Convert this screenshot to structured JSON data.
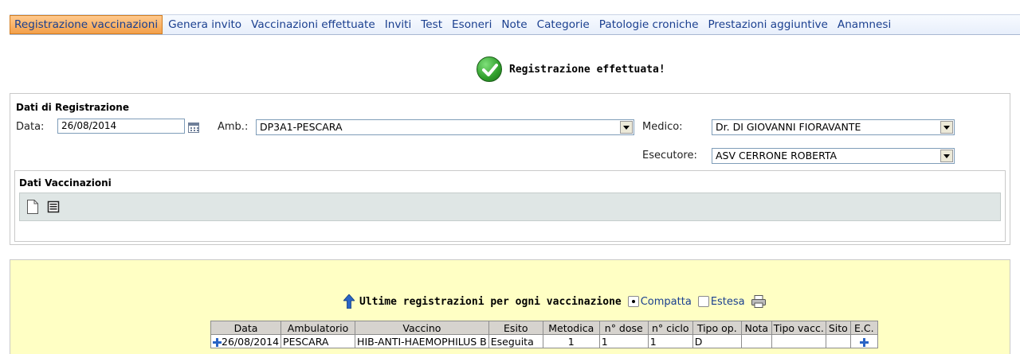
{
  "tabs": [
    {
      "label": "Registrazione vaccinazioni",
      "active": true
    },
    {
      "label": "Genera invito",
      "active": false
    },
    {
      "label": "Vaccinazioni effettuate",
      "active": false
    },
    {
      "label": "Inviti",
      "active": false
    },
    {
      "label": "Test",
      "active": false
    },
    {
      "label": "Esoneri",
      "active": false
    },
    {
      "label": "Note",
      "active": false
    },
    {
      "label": "Categorie",
      "active": false
    },
    {
      "label": "Patologie croniche",
      "active": false
    },
    {
      "label": "Prestazioni aggiuntive",
      "active": false
    },
    {
      "label": "Anamnesi",
      "active": false
    }
  ],
  "message": {
    "text": "Registrazione effettuata!",
    "icon": "check-circle-icon"
  },
  "registration": {
    "title": "Dati di Registrazione",
    "data_label": "Data:",
    "data_value": "26/08/2014",
    "amb_label": "Amb.:",
    "amb_value": "DP3A1-PESCARA",
    "medico_label": "Medico:",
    "medico_value": "Dr. DI GIOVANNI FIORAVANTE",
    "esecutore_label": "Esecutore:",
    "esecutore_value": "ASV CERRONE ROBERTA"
  },
  "vaccinations": {
    "title": "Dati Vaccinazioni",
    "buttons": [
      {
        "icon": "new-document-icon"
      },
      {
        "icon": "list-icon"
      }
    ]
  },
  "latest": {
    "title": "Ultime registrazioni per ogni vaccinazione",
    "options": [
      {
        "label": "Compatta",
        "selected": true
      },
      {
        "label": "Estesa",
        "selected": false
      }
    ],
    "columns": [
      "Data",
      "Ambulatorio",
      "Vaccino",
      "Esito",
      "Metodica",
      "n° dose",
      "n° ciclo",
      "Tipo op.",
      "Nota",
      "Tipo vacc.",
      "Sito",
      "E.C."
    ],
    "rows": [
      [
        "26/08/2014",
        "PESCARA",
        "HIB-ANTI-HAEMOPHILUS B",
        "Eseguita",
        "1",
        "1",
        "1",
        "D",
        "",
        "",
        "",
        ""
      ]
    ]
  },
  "colors": {
    "active_tab": "#f3a04a",
    "tab_text": "#1a3f8f",
    "yellow_area": "#ffffc4",
    "toolbar_bg": "#dfe6e5",
    "success": "#2f9e2b"
  }
}
